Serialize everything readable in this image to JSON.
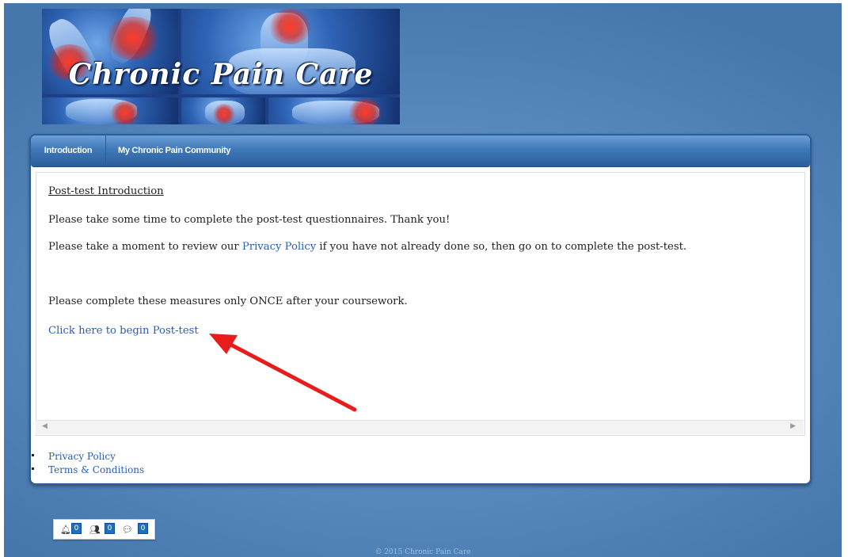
{
  "banner": {
    "title": "Chronic Pain Care"
  },
  "nav": {
    "tabs": [
      {
        "label": "Introduction"
      },
      {
        "label": "My Chronic Pain Community"
      }
    ]
  },
  "content": {
    "heading": "Post-test Introduction",
    "line1": "Please take some time to complete the post-test questionnaires. Thank you!",
    "line2_prefix": "Please take a moment to review our ",
    "line2_link": "Privacy Policy",
    "line2_suffix": " if you have not already done so, then go on to complete the post-test.",
    "line3": "Please complete these measures only ONCE after your coursework.",
    "begin_link": "Click here to begin Post-test"
  },
  "footer": {
    "links": [
      "Privacy Policy",
      "Terms & Conditions"
    ],
    "copyright": "© 2015 Chronic Pain Care"
  },
  "notifications": {
    "items": [
      {
        "icon": "bell-icon",
        "count": "0"
      },
      {
        "icon": "friends-icon",
        "count": "0"
      },
      {
        "icon": "messages-icon",
        "count": "0"
      }
    ]
  },
  "colors": {
    "background": "#5b8cc2",
    "nav": "#3f78b8",
    "link": "#2a5faa",
    "arrow": "#e81c1c"
  }
}
